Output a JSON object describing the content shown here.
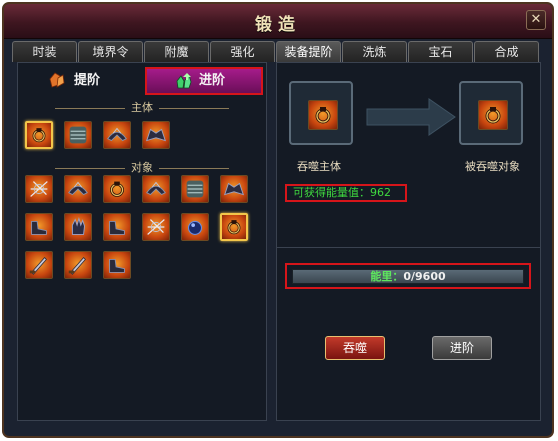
{
  "window": {
    "title": "锻造",
    "close_glyph": "✕"
  },
  "tabs": [
    "时装",
    "境界令",
    "附魔",
    "强化",
    "装备提阶",
    "洗炼",
    "宝石",
    "合成"
  ],
  "active_tab": "装备提阶",
  "subtabs": {
    "upgrade": "提阶",
    "advance": "进阶"
  },
  "left": {
    "main_label": "主体",
    "target_label": "对象"
  },
  "right": {
    "main_slot_caption": "吞噬主体",
    "target_slot_caption": "被吞噬对象",
    "energy_label": "可获得能量值：962",
    "energy_bar_label": "能里：",
    "energy_bar_value": "0/9600",
    "energy_fraction": 0.0
  },
  "buttons": {
    "devour": "吞噬",
    "advance": "进阶"
  },
  "colors": {
    "accent_red": "#d6151a",
    "energy_green": "#3fd83f",
    "advance_tab": "#a51c8a"
  }
}
